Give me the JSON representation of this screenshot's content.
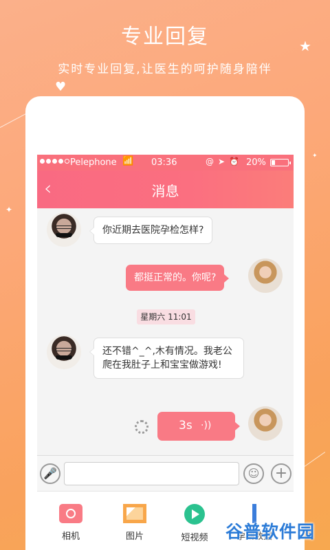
{
  "promo": {
    "title": "专业回复",
    "subtitle": "实时专业回复,让医生的呵护随身陪伴"
  },
  "status_bar": {
    "carrier": "Pelephone",
    "time": "03:36",
    "battery_percent": "20%"
  },
  "nav": {
    "back_icon": "‹",
    "title": "消息"
  },
  "messages": [
    {
      "from": "other",
      "text": "你近期去医院孕检怎样?"
    },
    {
      "from": "me",
      "text": "都挺正常的。你呢?"
    },
    {
      "from": "other",
      "text": "还不错^_^,木有情况。我老公爬在我肚子上和宝宝做游戏!"
    }
  ],
  "timestamp": "星期六  11:01",
  "voice_message": {
    "duration": "3s",
    "wave_icon": "·))"
  },
  "input_bar": {
    "mic_icon": "mic-icon",
    "emoji_icon": "smile-icon",
    "add_icon": "+"
  },
  "toolbar": {
    "items": [
      {
        "label": "相机",
        "icon": "camera-icon"
      },
      {
        "label": "图片",
        "icon": "image-icon"
      },
      {
        "label": "短视频",
        "icon": "play-icon"
      },
      {
        "label": "孕期数据",
        "icon": "data-icon"
      }
    ]
  },
  "watermark": {
    "text": "谷普软件园"
  },
  "colors": {
    "accent": "#f97a85",
    "background": "#fca879",
    "video": "#2bc28f"
  }
}
